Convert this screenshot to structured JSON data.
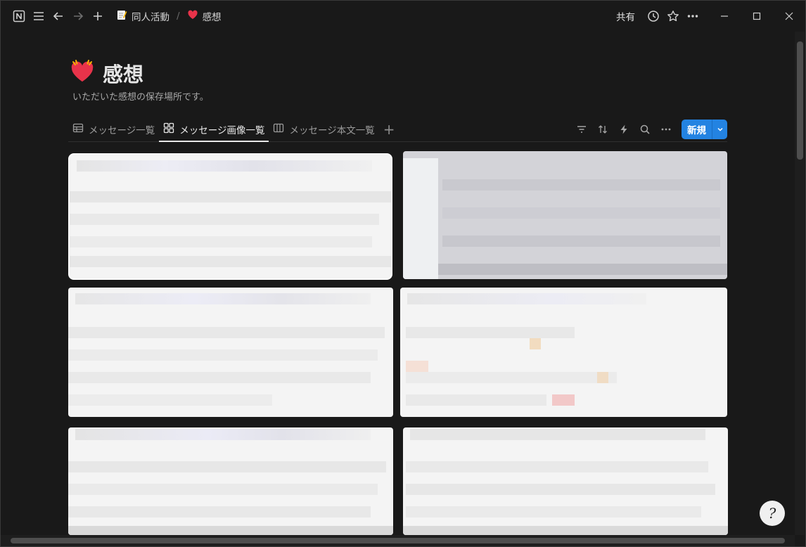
{
  "breadcrumb": {
    "parent": "同人活動",
    "current": "感想"
  },
  "header": {
    "share_label": "共有"
  },
  "page": {
    "title": "感想",
    "description": "いただいた感想の保存場所です。"
  },
  "tabs": [
    {
      "label": "メッセージ一覧",
      "icon": "table-icon",
      "active": false
    },
    {
      "label": "メッセージ画像一覧",
      "icon": "gallery-icon",
      "active": true
    },
    {
      "label": "メッセージ本文一覧",
      "icon": "board-icon",
      "active": false
    }
  ],
  "toolbar": {
    "new_label": "新規"
  },
  "help": {
    "label": "?"
  },
  "colors": {
    "accent": "#2383e2",
    "background": "#191919",
    "heart": "#e8334a"
  }
}
